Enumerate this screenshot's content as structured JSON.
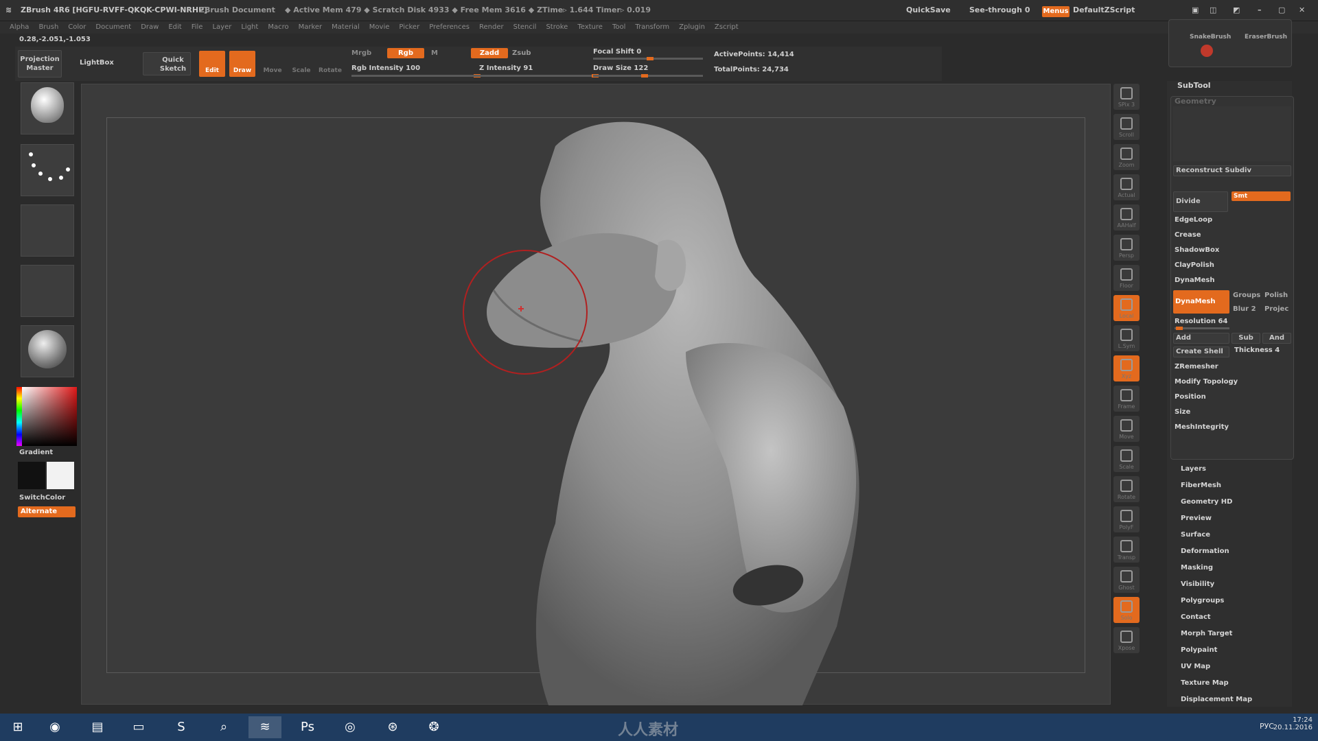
{
  "titlebar": {
    "app": "ZBrush 4R6 [HGFU-RVFF-QKQK-CPWI-NRHP]",
    "doc": "ZBrush Document",
    "mem": "◆ Active Mem 479 ◆ Scratch Disk 4933 ◆ Free Mem 3616 ◆ ZTime▹ 1.644 Timer▹ 0.019",
    "quicksave": "QuickSave",
    "seethrough": "See-through  0",
    "menus_btn": "Menus",
    "script": "DefaultZScript"
  },
  "menus": [
    "Alpha",
    "Brush",
    "Color",
    "Document",
    "Draw",
    "Edit",
    "File",
    "Layer",
    "Light",
    "Macro",
    "Marker",
    "Material",
    "Movie",
    "Picker",
    "Preferences",
    "Render",
    "Stencil",
    "Stroke",
    "Texture",
    "Tool",
    "Transform",
    "Zplugin",
    "Zscript"
  ],
  "coords": "0.28,-2.051,-1.053",
  "shelf": {
    "projection_master": "Projection Master",
    "lightbox": "LightBox",
    "quick_sketch": "Quick Sketch",
    "edit": "Edit",
    "draw": "Draw",
    "move": "Move",
    "scale": "Scale",
    "rotate": "Rotate",
    "mrgb": "Mrgb",
    "rgb": "Rgb",
    "m": "M",
    "rgb_intensity": "Rgb Intensity 100",
    "zadd": "Zadd",
    "zsub": "Zsub",
    "z_intensity": "Z Intensity 91",
    "focal_shift": "Focal Shift 0",
    "draw_size": "Draw Size 122",
    "active_points": "ActivePoints: 14,414",
    "total_points": "TotalPoints: 24,734"
  },
  "left": {
    "gradient": "Gradient",
    "switch_color": "SwitchColor",
    "alternate": "Alternate"
  },
  "right_tools": [
    "SPix 3",
    "Scroll",
    "Zoom",
    "Actual",
    "AAHalf",
    "Persp",
    "Floor",
    "Local",
    "L.Sym",
    "Xyz",
    "Frame",
    "Move",
    "Scale",
    "Rotate",
    "PolyF",
    "Transp",
    "Ghost",
    "Solo",
    "Xpose"
  ],
  "panel": {
    "brush1": "SnakeBrush",
    "brush2": "EraserBrush",
    "subtool": "SubTool",
    "geometry": "Geometry",
    "reconstruct": "Reconstruct Subdiv",
    "divide": "Divide",
    "smt": "Smt",
    "edgeloop": "EdgeLoop",
    "crease": "Crease",
    "shadowbox": "ShadowBox",
    "claypolish": "ClayPolish",
    "dynamesh_head": "DynaMesh",
    "dynamesh_btn": "DynaMesh",
    "groups": "Groups",
    "polish": "Polish",
    "blur": "Blur 2",
    "project": "Projec",
    "resolution": "Resolution 64",
    "add": "Add",
    "sub": "Sub",
    "and": "And",
    "create_shell": "Create Shell",
    "thickness": "Thickness 4",
    "zremesher": "ZRemesher",
    "modify_topology": "Modify Topology",
    "position": "Position",
    "size": "Size",
    "meshintegrity": "MeshIntegrity",
    "list": [
      "Layers",
      "FiberMesh",
      "Geometry HD",
      "Preview",
      "Surface",
      "Deformation",
      "Masking",
      "Visibility",
      "Polygroups",
      "Contact",
      "Morph Target",
      "Polypaint",
      "UV Map",
      "Texture Map",
      "Displacement Map"
    ]
  },
  "taskbar": {
    "lang": "РУС",
    "time": "17:24",
    "date": "20.11.2016",
    "watermark": "人人素材"
  }
}
